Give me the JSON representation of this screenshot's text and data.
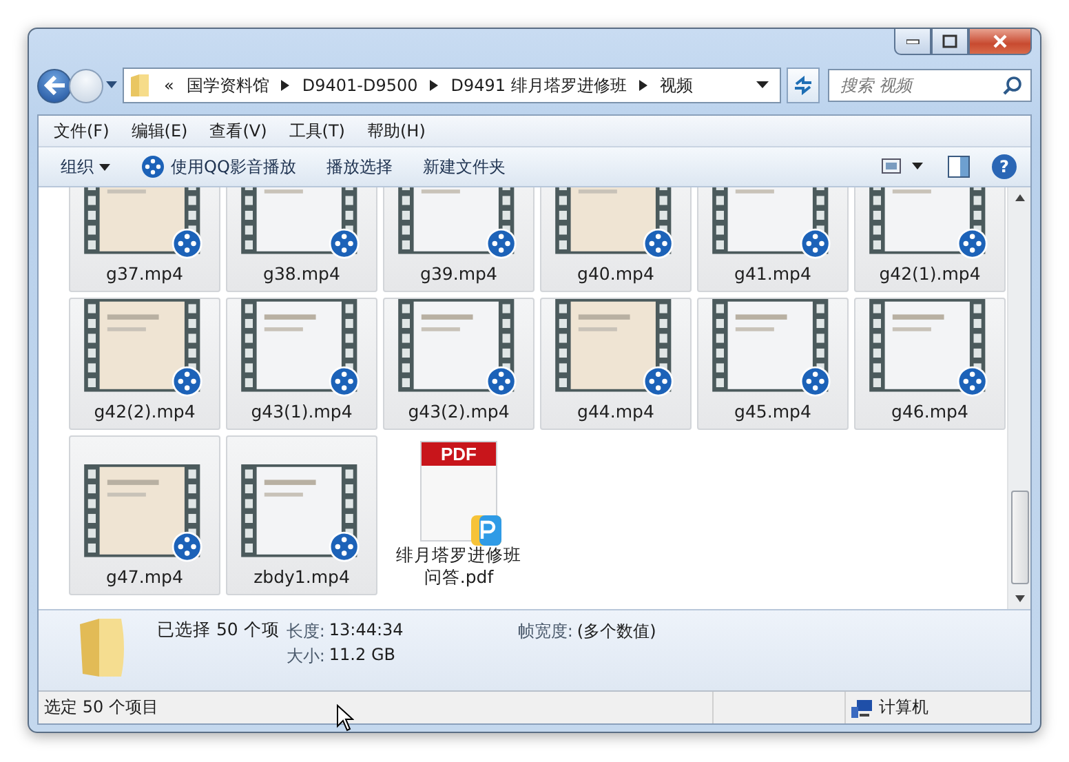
{
  "address": {
    "overflow": "«",
    "path": [
      "国学资料馆",
      "D9401-D9500",
      "D9491 绯月塔罗进修班",
      "视频"
    ],
    "search_placeholder": "搜索 视频"
  },
  "help": "?",
  "menu": [
    "文件(F)",
    "编辑(E)",
    "查看(V)",
    "工具(T)",
    "帮助(H)"
  ],
  "toolbar": [
    {
      "label": "组织",
      "kind": "dropdown"
    },
    {
      "label": "使用QQ影音播放",
      "kind": "player"
    },
    {
      "label": "播放选择",
      "kind": "plain"
    },
    {
      "label": "新建文件夹",
      "kind": "plain"
    }
  ],
  "files": [
    {
      "name": "g37.mp4",
      "kind": "video",
      "selected": true
    },
    {
      "name": "g38.mp4",
      "kind": "video",
      "selected": true
    },
    {
      "name": "g39.mp4",
      "kind": "video",
      "selected": true
    },
    {
      "name": "g40.mp4",
      "kind": "video",
      "selected": true
    },
    {
      "name": "g41.mp4",
      "kind": "video",
      "selected": true
    },
    {
      "name": "g42(1).mp4",
      "kind": "video",
      "selected": true
    },
    {
      "name": "g42(2).mp4",
      "kind": "video",
      "selected": true
    },
    {
      "name": "g43(1).mp4",
      "kind": "video",
      "selected": true
    },
    {
      "name": "g43(2).mp4",
      "kind": "video",
      "selected": true
    },
    {
      "name": "g44.mp4",
      "kind": "video",
      "selected": true
    },
    {
      "name": "g45.mp4",
      "kind": "video",
      "selected": true
    },
    {
      "name": "g46.mp4",
      "kind": "video",
      "selected": true
    },
    {
      "name": "g47.mp4",
      "kind": "video",
      "selected": true
    },
    {
      "name": "zbdy1.mp4",
      "kind": "video",
      "selected": true
    },
    {
      "name": "绯月塔罗进修班问答.pdf",
      "kind": "pdf",
      "selected": false,
      "badge": "PDF"
    }
  ],
  "details": {
    "selection": "已选择 50 个项",
    "fields": [
      {
        "label": "长度:",
        "value": "13:44:34"
      },
      {
        "label": "大小:",
        "value": "11.2 GB"
      },
      {
        "label": "帧宽度:",
        "value": "(多个数值)"
      }
    ]
  },
  "status": {
    "text": "选定 50 个项目",
    "location": "计算机"
  }
}
